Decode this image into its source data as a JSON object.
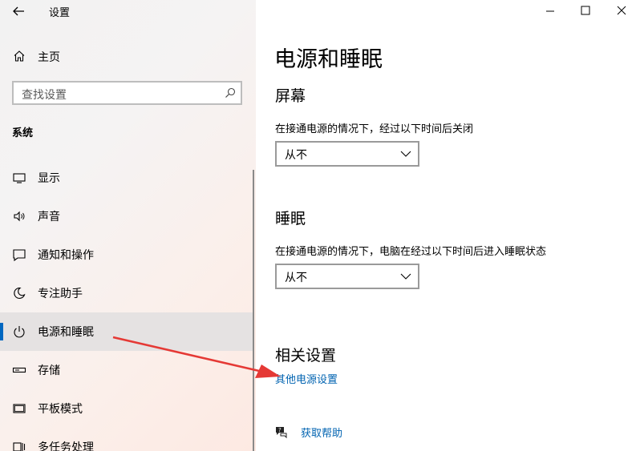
{
  "app": {
    "title": "设置"
  },
  "sidebar": {
    "home_label": "主页",
    "search_placeholder": "查找设置",
    "section": "系统",
    "items": [
      {
        "label": "显示",
        "icon": "display-icon"
      },
      {
        "label": "声音",
        "icon": "speaker-icon"
      },
      {
        "label": "通知和操作",
        "icon": "notification-icon"
      },
      {
        "label": "专注助手",
        "icon": "moon-icon"
      },
      {
        "label": "电源和睡眠",
        "icon": "power-icon",
        "selected": true
      },
      {
        "label": "存储",
        "icon": "storage-icon"
      },
      {
        "label": "平板模式",
        "icon": "tablet-icon"
      },
      {
        "label": "多任务处理",
        "icon": "multitask-icon"
      }
    ]
  },
  "main": {
    "title": "电源和睡眠",
    "screen": {
      "heading": "屏幕",
      "desc": "在接通电源的情况下，经过以下时间后关闭",
      "value": "从不"
    },
    "sleep": {
      "heading": "睡眠",
      "desc": "在接通电源的情况下，电脑在经过以下时间后进入睡眠状态",
      "value": "从不"
    },
    "related": {
      "heading": "相关设置",
      "link": "其他电源设置"
    },
    "help_link": "获取帮助"
  },
  "colors": {
    "accent": "#0067c0",
    "link": "#0063b1",
    "arrow": "#e53935"
  }
}
